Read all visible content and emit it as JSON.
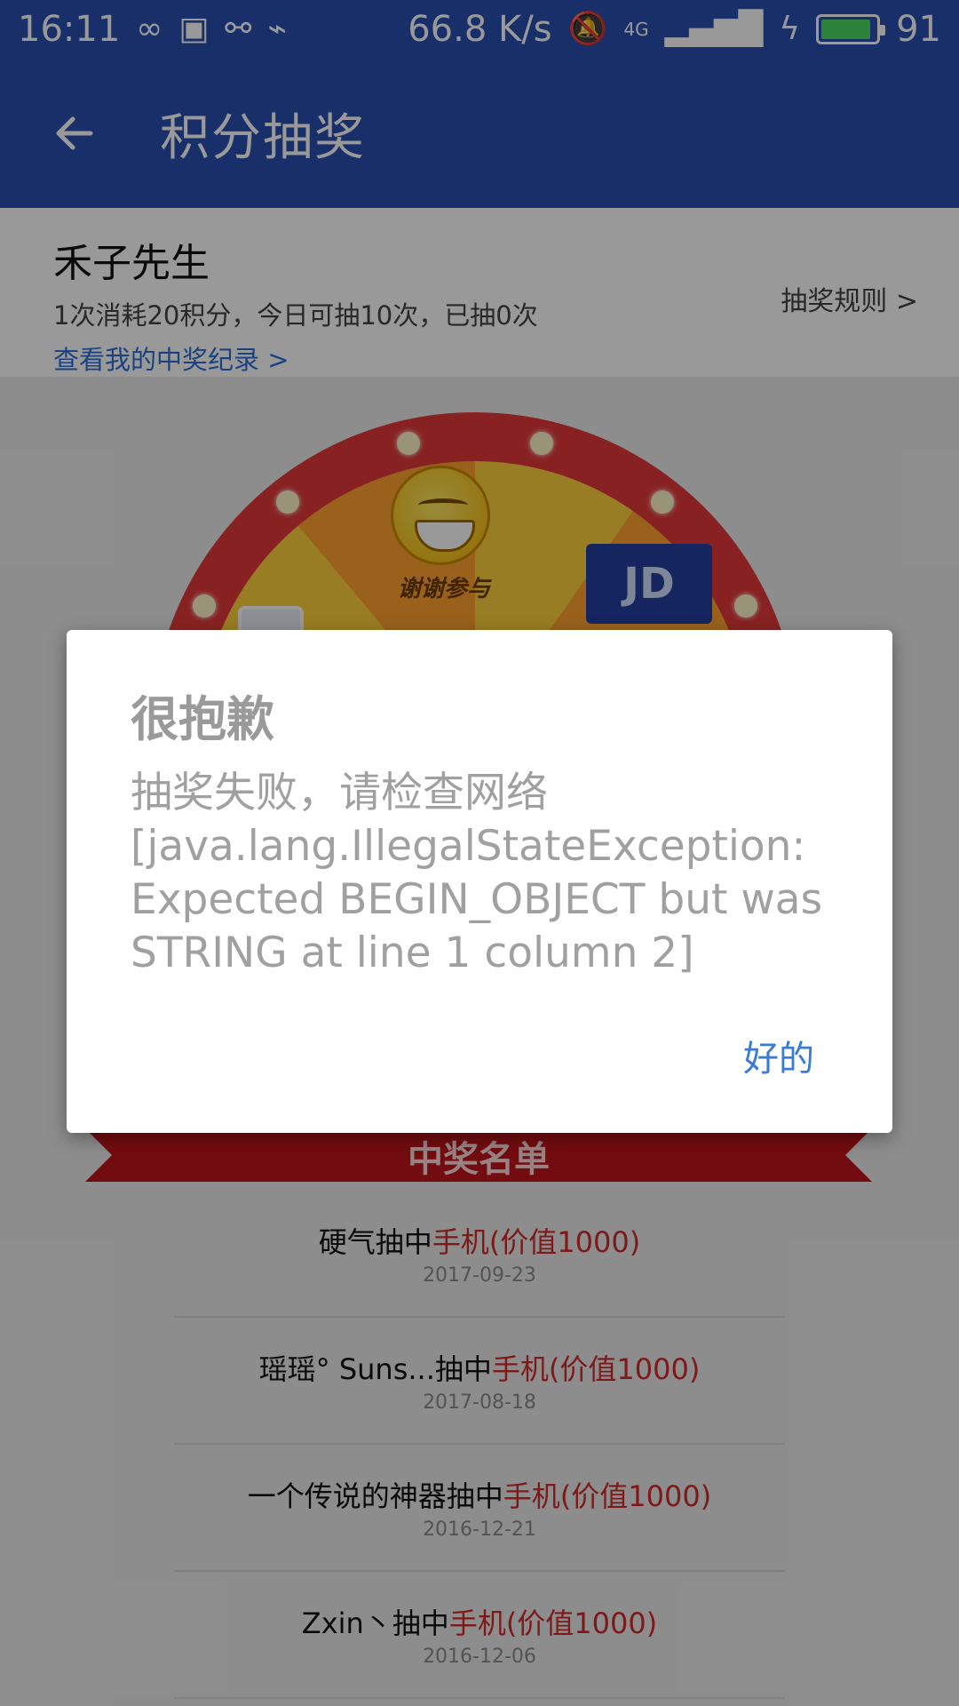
{
  "status_bar": {
    "time": "16:11",
    "network_speed": "66.8 K/s",
    "signal_type": "4G",
    "battery_percent": "91",
    "battery_level": 0.91,
    "left_icons": [
      "infinity-icon",
      "image-icon",
      "share-icon",
      "usb-icon"
    ],
    "right_icons": [
      "mute-icon",
      "signal-icon",
      "charging-icon",
      "battery-icon"
    ]
  },
  "app_bar": {
    "title": "积分抽奖",
    "back_icon": "arrow-left-icon"
  },
  "user_panel": {
    "name": "禾子先生",
    "description": "1次消耗20积分，今日可抽10次，已抽0次",
    "record_link": "查看我的中奖纪录 >",
    "rules_link": "抽奖规则 >"
  },
  "wheel": {
    "segment_label": "谢谢参与",
    "card_label": "JD",
    "ribbon_title": "中奖名单",
    "colors": {
      "ring": "#e33a3a",
      "segment_a": "#ffd13c",
      "segment_b": "#ffa22f",
      "ribbon": "#c0141b"
    }
  },
  "winners": [
    {
      "name": "硬气抽中",
      "prize": "手机(价值1000)",
      "date": "2017-09-23"
    },
    {
      "name": "瑶瑶° Suns...抽中",
      "prize": "手机(价值1000)",
      "date": "2017-08-18"
    },
    {
      "name": "一个传说的神器抽中",
      "prize": "手机(价值1000)",
      "date": "2016-12-21"
    },
    {
      "name": "Zxin丶抽中",
      "prize": "手机(价值1000)",
      "date": "2016-12-06"
    }
  ],
  "dialog": {
    "title": "很抱歉",
    "message": "抽奖失败，请检查网络\n[java.lang.IllegalStateException:\nExpected BEGIN_OBJECT but was\nSTRING at line 1 column 2]",
    "ok_label": "好的"
  },
  "colors": {
    "primary": "#2a4fb0",
    "link": "#2d6fd6",
    "prize_red": "#d22a2a",
    "dialog_action": "#3a7bd5"
  }
}
